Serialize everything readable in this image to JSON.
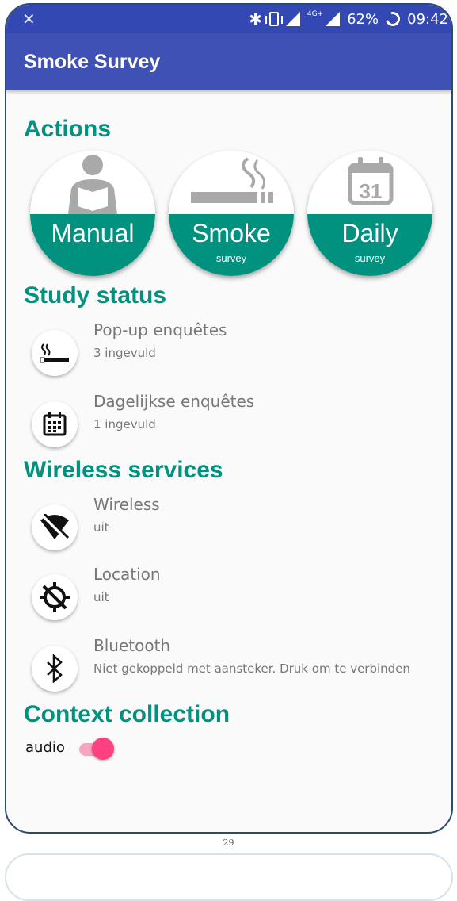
{
  "status_bar": {
    "battery_percent": "62%",
    "time": "09:42"
  },
  "app_bar": {
    "title": "Smoke Survey"
  },
  "sections": {
    "actions": "Actions",
    "study_status": "Study status",
    "wireless_services": "Wireless services",
    "context_collection": "Context collection"
  },
  "actions": [
    {
      "label": "Manual",
      "sublabel": "",
      "icon": "reading-person-icon"
    },
    {
      "label": "Smoke",
      "sublabel": "survey",
      "icon": "cigarette-icon"
    },
    {
      "label": "Daily",
      "sublabel": "survey",
      "icon": "calendar-31-icon"
    }
  ],
  "calendar_day": "31",
  "study_status": [
    {
      "title": "Pop-up enquêtes",
      "subtitle": "3 ingevuld",
      "icon": "cigarette-icon"
    },
    {
      "title": "Dagelijkse enquêtes",
      "subtitle": "1 ingevuld",
      "icon": "calendar-icon"
    }
  ],
  "wireless": [
    {
      "title": "Wireless",
      "subtitle": "uit",
      "icon": "wifi-off-icon"
    },
    {
      "title": "Location",
      "subtitle": "uit",
      "icon": "location-off-icon"
    },
    {
      "title": "Bluetooth",
      "subtitle": "Niet gekoppeld met aansteker. Druk om te verbinden",
      "icon": "bluetooth-icon"
    }
  ],
  "context": {
    "audio_label": "audio",
    "audio_enabled": true
  },
  "page_number": "29",
  "colors": {
    "primary": "#3f51b5",
    "status_bar": "#3448b3",
    "accent_teal": "#00917f",
    "toggle_pink": "#ff4081"
  }
}
